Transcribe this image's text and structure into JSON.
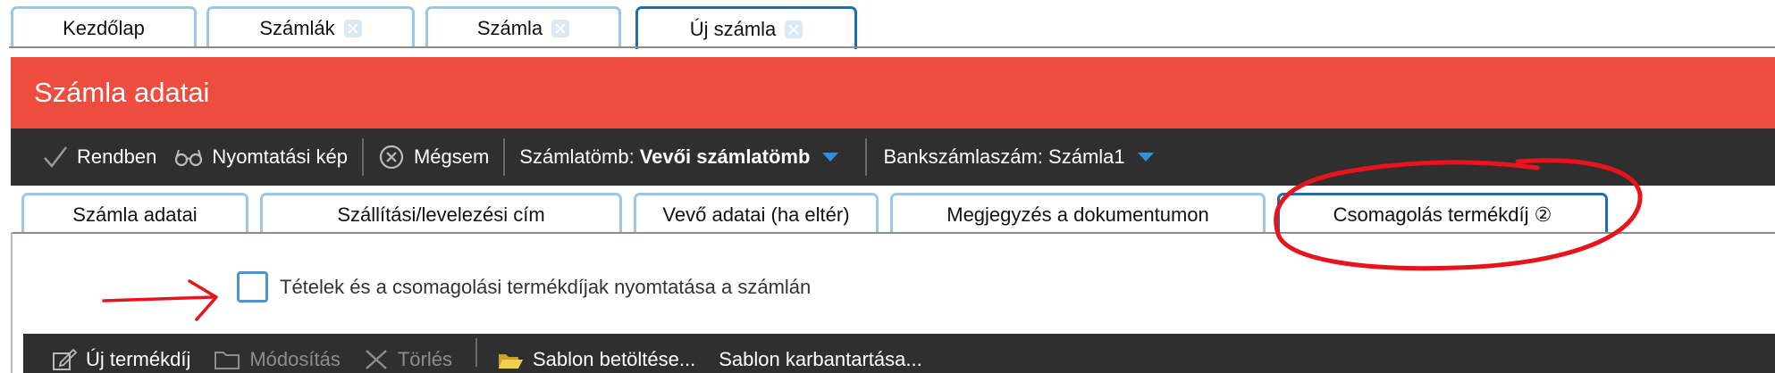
{
  "top_tabs": [
    {
      "label": "Kezdőlap",
      "closable": false,
      "active": false
    },
    {
      "label": "Számlák",
      "closable": true,
      "active": false
    },
    {
      "label": "Számla",
      "closable": true,
      "active": false
    },
    {
      "label": "Új számla",
      "closable": true,
      "active": true
    }
  ],
  "panel": {
    "title": "Számla adatai"
  },
  "toolbar": {
    "ok_label": "Rendben",
    "print_preview_label": "Nyomtatási kép",
    "cancel_label": "Mégsem",
    "invoice_block_label": "Számlatömb:",
    "invoice_block_value": "Vevői számlatömb",
    "bank_account_label": "Bankszámlaszám: Számla1"
  },
  "sub_tabs": [
    {
      "label": "Számla adatai",
      "active": false
    },
    {
      "label": "Szállítási/levelezési cím",
      "active": false
    },
    {
      "label": "Vevő adatai (ha eltér)",
      "active": false
    },
    {
      "label": "Megjegyzés a dokumentumon",
      "active": false
    },
    {
      "label": "Csomagolás termékdíj ②",
      "active": true
    }
  ],
  "checkbox": {
    "label": "Tételek és a csomagolási termékdíjak nyomtatása a számlán",
    "checked": false
  },
  "product_toolbar": {
    "new_label": "Új termékdíj",
    "modify_label": "Módosítás",
    "delete_label": "Törlés",
    "load_template_label": "Sablon betöltése...",
    "manage_templates_label": "Sablon karbantartása..."
  },
  "colors": {
    "header": "#ef4c40",
    "toolbar": "#2f2f2f",
    "tab_border": "#9cc6e8",
    "active_tab_border": "#1d6fb3",
    "annotation": "#e8131b"
  }
}
